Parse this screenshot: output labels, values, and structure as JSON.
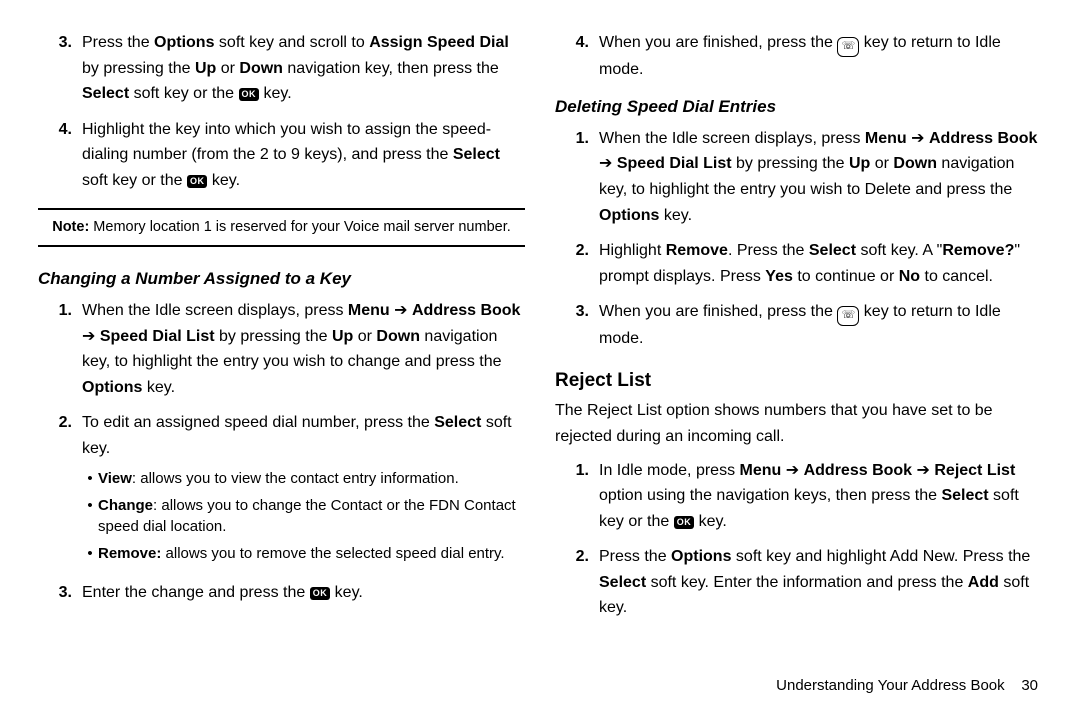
{
  "left": {
    "steps_a": [
      {
        "n": "3.",
        "pre": "Press the ",
        "b1": "Options",
        "mid1": " soft key and scroll to ",
        "b2": "Assign Speed Dial",
        "mid2": " by pressing the ",
        "b3": "Up",
        "mid3": " or ",
        "b4": "Down",
        "mid4": " navigation key, then press the ",
        "b5": "Select",
        "mid5": " soft key or the ",
        "ok": true,
        "tail": " key."
      },
      {
        "n": "4.",
        "pre": "Highlight the key into which you wish to assign the speed-dialing number (from the 2 to 9 keys), and press the ",
        "b1": "Select",
        "mid1": " soft key or the ",
        "ok": true,
        "tail": " key."
      }
    ],
    "note_pre": "Note:",
    "note_body": " Memory location 1 is reserved for your Voice mail server number.",
    "h1": "Changing a Number Assigned to a Key",
    "steps_b": [
      {
        "n": "1.",
        "pre": "When the Idle screen displays, press ",
        "b1": "Menu",
        "arrow1": " ➔ ",
        "b2": "Address Book",
        "arrow2": " ➔ ",
        "b3": "Speed Dial List",
        "mid1": " by pressing the ",
        "b4": "Up",
        "mid2": " or ",
        "b5": "Down",
        "mid3": " navigation key, to highlight the entry you wish to change and press the ",
        "b6": "Options",
        "tail": " key."
      },
      {
        "n": "2.",
        "pre": "To edit an assigned speed dial number, press the ",
        "b1": "Select",
        "tail": " soft key."
      }
    ],
    "bullets": [
      {
        "b": "View",
        "t": ": allows you to view the contact entry information."
      },
      {
        "b": "Change",
        "t": ": allows you to change the Contact or the FDN Contact speed dial location."
      },
      {
        "b": "Remove:",
        "t": " allows you to remove the selected speed dial entry."
      }
    ],
    "step_b3": {
      "n": "3.",
      "pre": "Enter the change and press the ",
      "ok": true,
      "tail": " key."
    }
  },
  "right": {
    "step_c4": {
      "n": "4.",
      "pre": "When you are finished, press the ",
      "end": true,
      "tail": " key to return to Idle mode."
    },
    "h2": "Deleting Speed Dial Entries",
    "steps_d": [
      {
        "n": "1.",
        "pre": "When the Idle screen displays, press ",
        "b1": "Menu",
        "arrow1": " ➔ ",
        "b2": "Address Book",
        "arrow2": " ➔ ",
        "b3": "Speed Dial List",
        "mid1": " by pressing the ",
        "b4": "Up",
        "mid2": " or ",
        "b5": "Down",
        "mid3": " navigation key, to highlight the entry you wish to Delete and press the ",
        "b6": "Options",
        "tail": " key."
      },
      {
        "n": "2.",
        "pre": "Highlight ",
        "b1": "Remove",
        "mid1": ". Press the ",
        "b2": "Select",
        "mid2": " soft key. A \"",
        "b3": "Remove?",
        "mid3": "\" prompt displays. Press ",
        "b4": "Yes",
        "mid4": " to continue or ",
        "b5": "No",
        "tail": " to cancel."
      },
      {
        "n": "3.",
        "pre": "When you are finished, press the ",
        "end": true,
        "tail": " key to return to Idle mode."
      }
    ],
    "h3": "Reject List",
    "reject_intro": "The Reject List option shows numbers that you have set to be rejected during an incoming call.",
    "steps_e": [
      {
        "n": "1.",
        "pre": "In Idle mode, press ",
        "b1": "Menu",
        "arrow1": " ➔ ",
        "b2": "Address Book",
        "arrow2": " ➔ ",
        "b3": "Reject List",
        "mid1": " option using the navigation keys, then press the ",
        "b4": "Select",
        "mid2": " soft key or the ",
        "ok": true,
        "tail": " key."
      },
      {
        "n": "2.",
        "pre": "Press the ",
        "b1": "Options",
        "mid1": " soft key and highlight Add New. Press the ",
        "b2": "Select",
        "mid2": " soft key. Enter the information and press the ",
        "b3": "Add",
        "tail": " soft key."
      }
    ]
  },
  "footer": {
    "section": "Understanding Your Address Book",
    "page": "30"
  },
  "ok_label": "OK",
  "end_label": "☏"
}
